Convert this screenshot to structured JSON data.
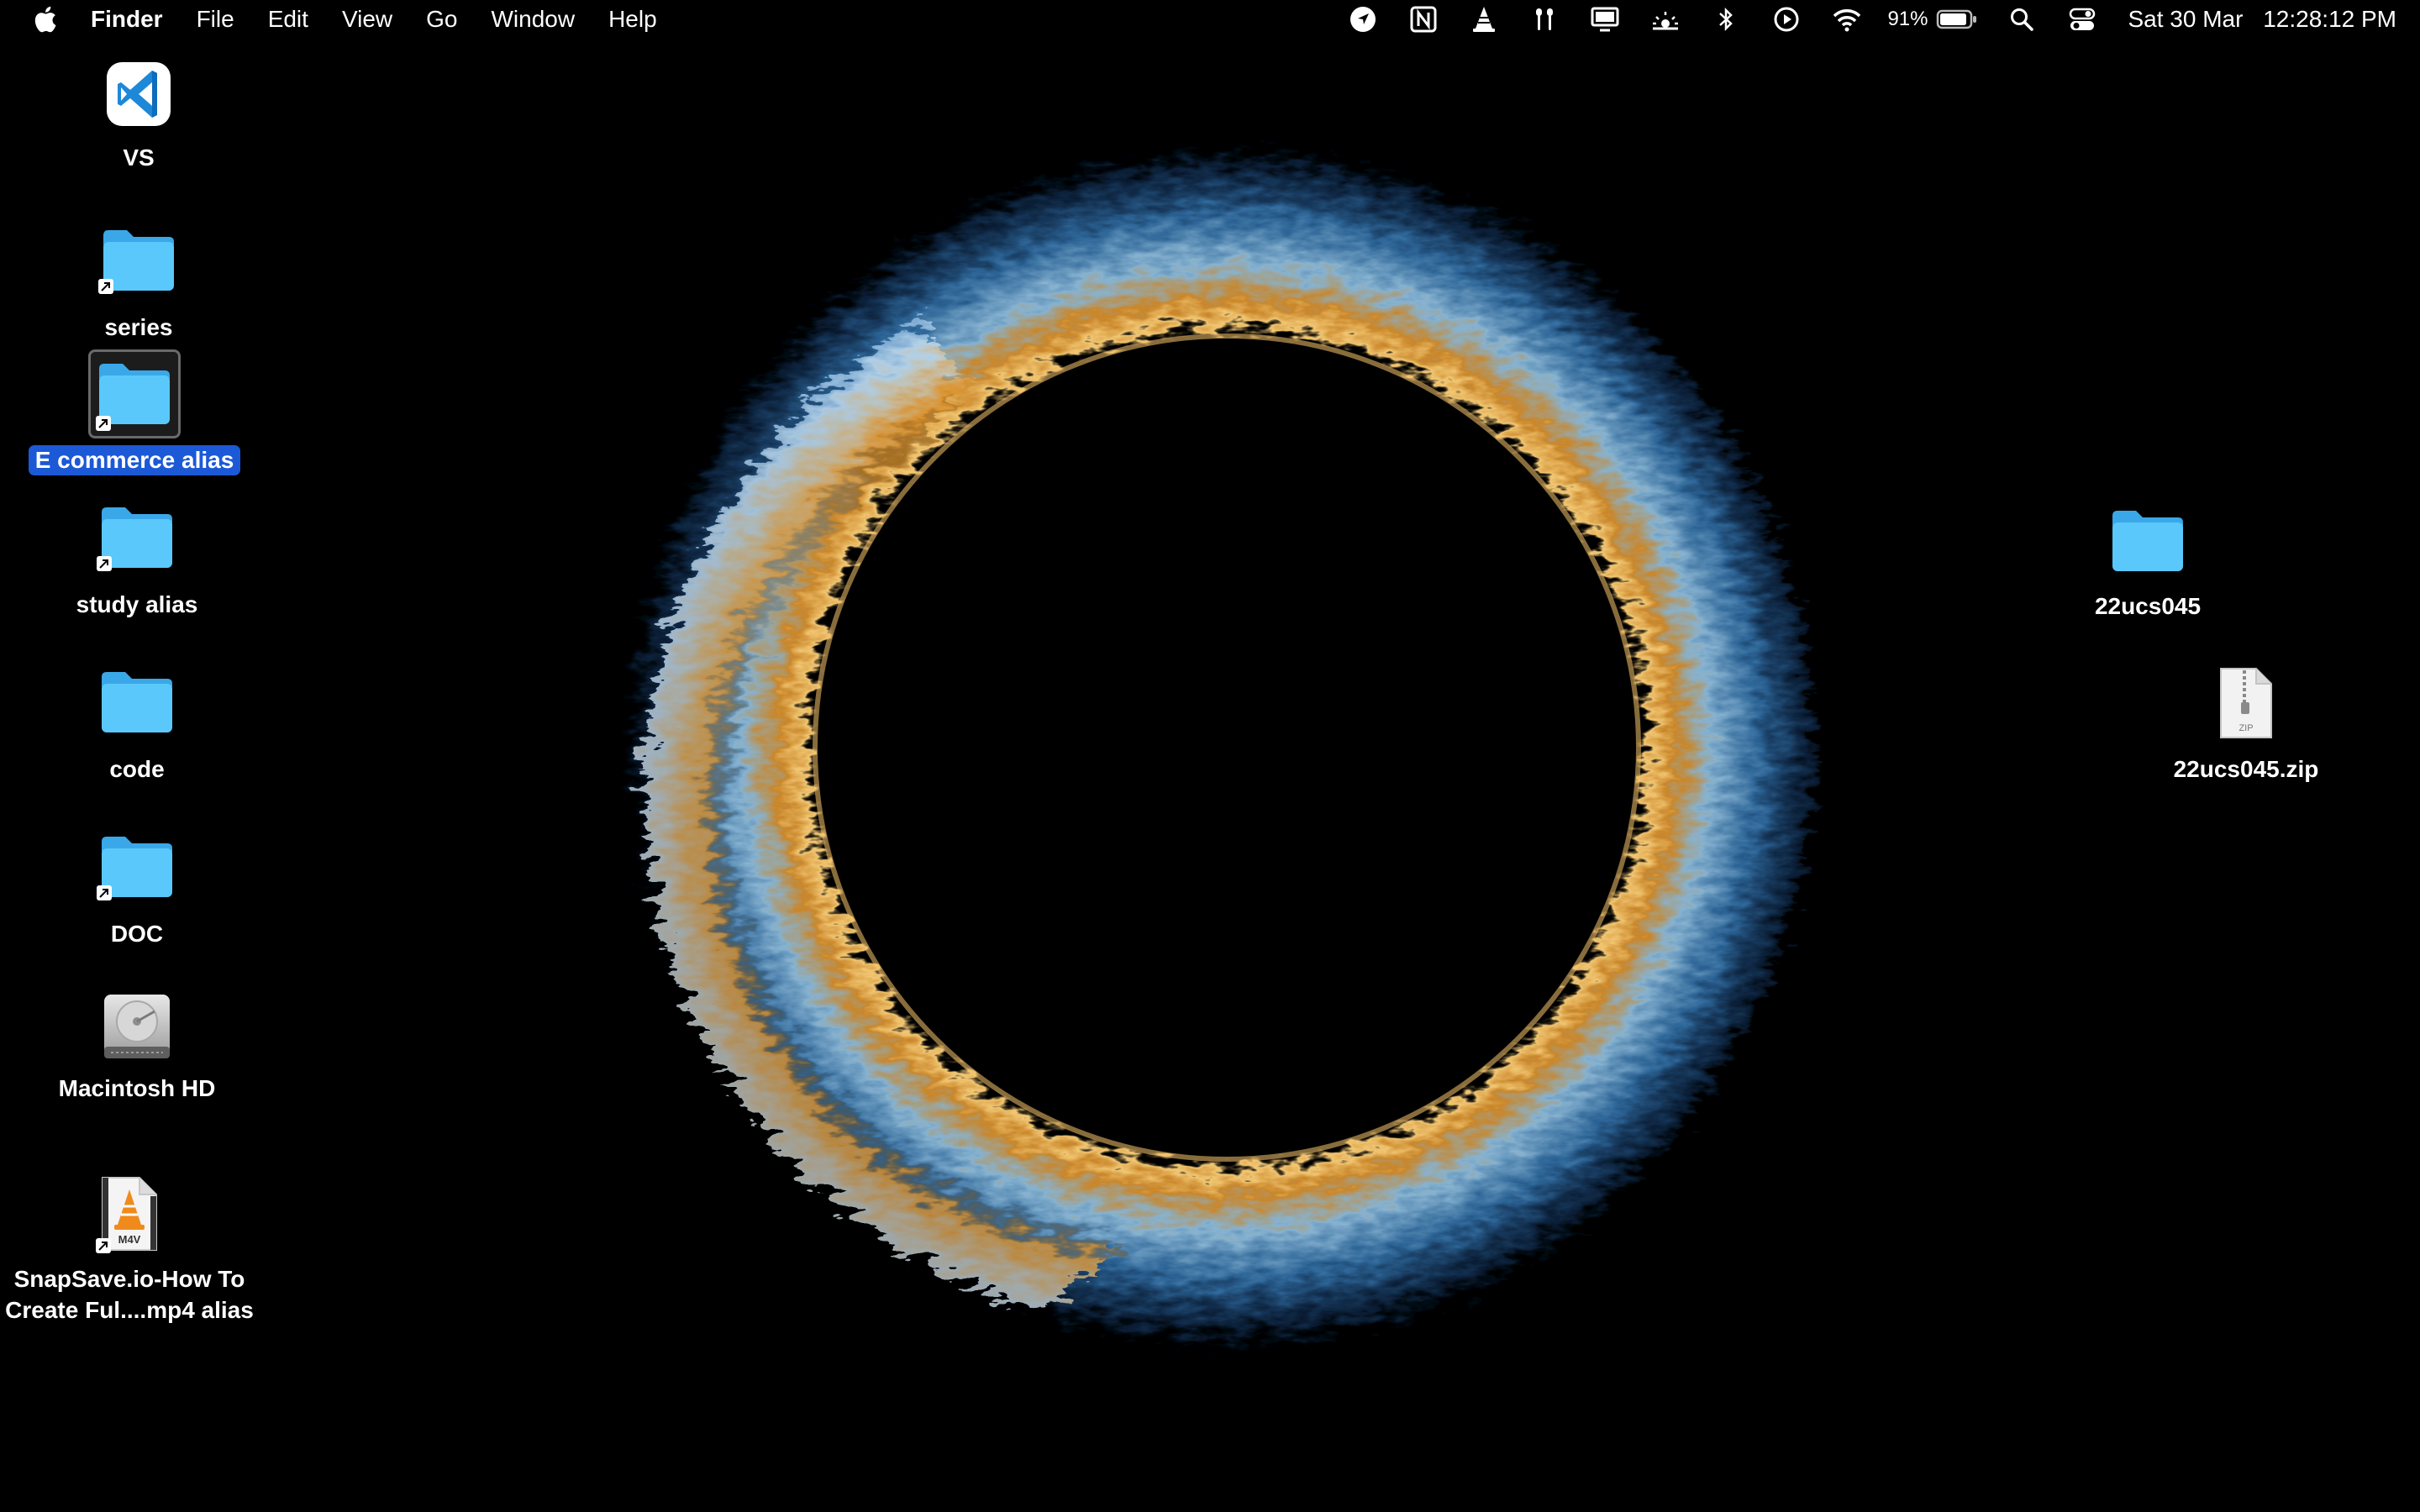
{
  "menubar": {
    "app_name": "Finder",
    "menus": [
      "File",
      "Edit",
      "View",
      "Go",
      "Window",
      "Help"
    ],
    "status_icons": [
      "location-icon",
      "notion-icon",
      "vlc-icon",
      "airpods-icon",
      "display-icon",
      "brightness-icon",
      "bluetooth-icon",
      "play-icon",
      "wifi-icon"
    ],
    "battery_percent": "91%",
    "battery_level": 0.91,
    "date": "Sat 30 Mar",
    "time": "12:28:12 PM"
  },
  "desktop": {
    "icons": [
      {
        "label": "VS",
        "type": "app-vscode"
      },
      {
        "label": "series",
        "type": "folder-alias"
      },
      {
        "label": "E commerce alias",
        "type": "folder-alias",
        "selected": true
      },
      {
        "label": "study alias",
        "type": "folder-alias"
      },
      {
        "label": "code",
        "type": "folder"
      },
      {
        "label": "DOC",
        "type": "folder-alias"
      },
      {
        "label": "Macintosh HD",
        "type": "hard-drive"
      },
      {
        "label_line1": "SnapSave.io-How To",
        "label_line2": "Create Ful....mp4 alias",
        "type": "m4v-alias",
        "file_badge": "M4V"
      },
      {
        "label": "22ucs045",
        "type": "folder"
      },
      {
        "label": "22ucs045.zip",
        "type": "zip",
        "file_badge": "ZIP"
      }
    ]
  },
  "colors": {
    "folder": "#5ac8fa",
    "selection": "#1c59d6",
    "wallpaper_blue": "#4aa6e8",
    "wallpaper_orange": "#e0952e"
  }
}
